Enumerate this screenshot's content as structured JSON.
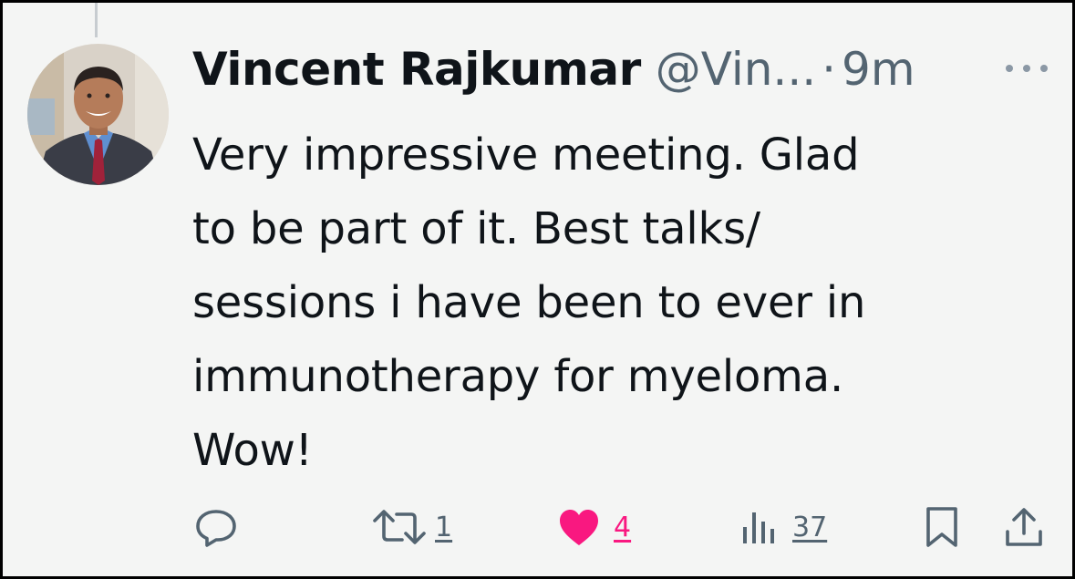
{
  "tweet": {
    "author_name": "Vincent Rajkumar",
    "handle": "@Vin...",
    "separator": "·",
    "time": "9m",
    "text": "Very impressive meeting. Glad\nto be part of it. Best talks/\nsessions i have been to ever in\nimmunotherapy for myeloma.\nWow!"
  },
  "actions": {
    "reply": {
      "icon": "reply-icon"
    },
    "retweet": {
      "icon": "retweet-icon",
      "count": "1"
    },
    "like": {
      "icon": "heart-icon",
      "count": "4",
      "color": "#f91880"
    },
    "views": {
      "icon": "views-icon",
      "count": "37"
    },
    "bookmark": {
      "icon": "bookmark-icon"
    },
    "share": {
      "icon": "share-icon"
    }
  },
  "colors": {
    "background": "#f4f5f4",
    "text": "#0f1419",
    "secondary": "#536471",
    "like": "#f91880"
  }
}
